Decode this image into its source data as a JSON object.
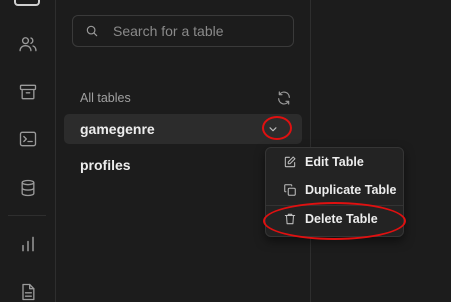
{
  "rail": {
    "icons": [
      "table-editor-icon",
      "users-icon",
      "archive-icon",
      "terminal-icon",
      "database-icon",
      "reports-icon",
      "docs-icon"
    ]
  },
  "search": {
    "placeholder": "Search for a table",
    "value": ""
  },
  "tables_section": {
    "title": "All tables"
  },
  "tables": [
    {
      "name": "gamegenre",
      "active": true
    },
    {
      "name": "profiles",
      "active": false
    }
  ],
  "context_menu": {
    "items": [
      {
        "label": "Edit Table",
        "icon": "edit-icon"
      },
      {
        "label": "Duplicate Table",
        "icon": "copy-icon"
      },
      {
        "label": "Delete Table",
        "icon": "trash-icon"
      }
    ]
  },
  "colors": {
    "background": "#1c1c1c",
    "active_row": "#2c2c2c",
    "annotation": "#e01010"
  }
}
